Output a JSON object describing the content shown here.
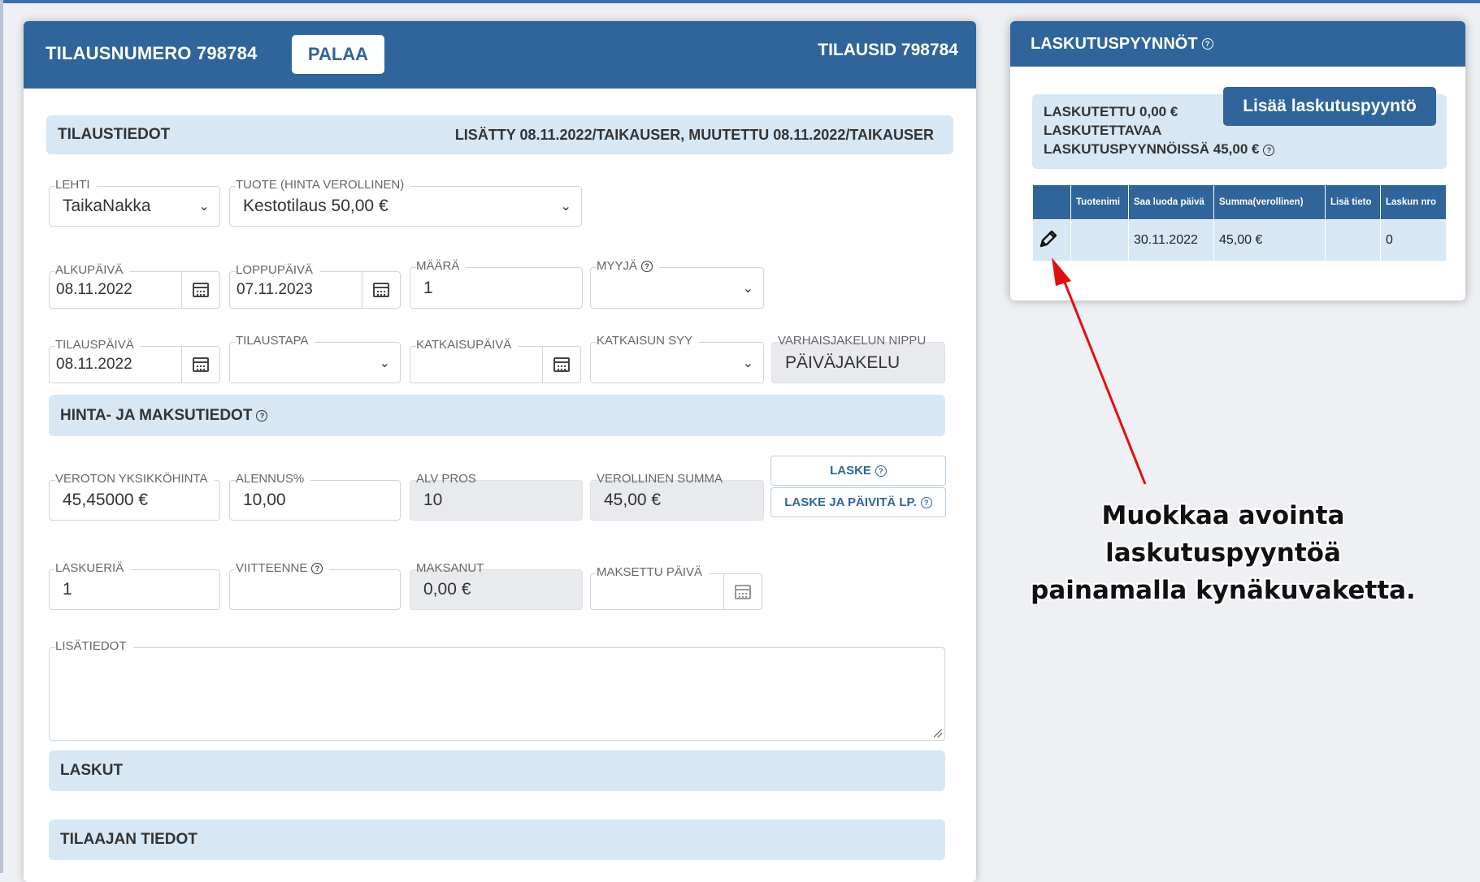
{
  "header": {
    "order_number": "TILAUSNUMERO 798784",
    "back_button": "PALAA",
    "order_id": "TILAUSID 798784"
  },
  "order_info": {
    "title": "TILAUSTIEDOT",
    "meta": "LISÄTTY 08.11.2022/TAIKAUSER, MUUTETTU 08.11.2022/TAIKAUSER"
  },
  "fields": {
    "magazine": {
      "label": "LEHTI",
      "value": "TaikaNakka"
    },
    "product": {
      "label": "TUOTE (HINTA VEROLLINEN)",
      "value": "Kestotilaus 50,00 €"
    },
    "start_date": {
      "label": "ALKUPÄIVÄ",
      "value": "08.11.2022"
    },
    "end_date": {
      "label": "LOPPUPÄIVÄ",
      "value": "07.11.2023"
    },
    "quantity": {
      "label": "MÄÄRÄ",
      "value": "1"
    },
    "seller": {
      "label": "MYYJÄ",
      "value": ""
    },
    "order_date": {
      "label": "TILAUSPÄIVÄ",
      "value": "08.11.2022"
    },
    "order_method": {
      "label": "TILAUSTAPA",
      "value": ""
    },
    "cutoff_date": {
      "label": "KATKAISUPÄIVÄ",
      "value": ""
    },
    "cutoff_reason": {
      "label": "KATKAISUN SYY",
      "value": ""
    },
    "early_bundle": {
      "label": "VARHAISJAKELUN NIPPU",
      "value": "PÄIVÄJAKELU"
    },
    "unit_price": {
      "label": "VEROTON YKSIKKÖHINTA",
      "value": "45,45000 €"
    },
    "discount": {
      "label": "ALENNUS%",
      "value": "10,00"
    },
    "vat": {
      "label": "ALV PROS",
      "value": "10"
    },
    "total": {
      "label": "VEROLLINEN SUMMA",
      "value": "45,00 €"
    },
    "installments": {
      "label": "LASKUERIÄ",
      "value": "1"
    },
    "reference": {
      "label": "VIITTEENNE",
      "value": ""
    },
    "paid": {
      "label": "MAKSANUT",
      "value": "0,00 €"
    },
    "paid_date": {
      "label": "MAKSETTU PÄIVÄ",
      "value": ""
    },
    "notes": {
      "label": "LISÄTIEDOT",
      "value": ""
    }
  },
  "price_section": {
    "title": "HINTA- JA MAKSUTIEDOT"
  },
  "buttons": {
    "calc": "LASKE",
    "calc_update": "LASKE JA PÄIVITÄ LP."
  },
  "invoices_section": {
    "title": "LASKUT"
  },
  "customer_section": {
    "title": "TILAAJAN TIEDOT"
  },
  "billing": {
    "title": "LASKUTUSPYYNNÖT",
    "invoiced": "LASKUTETTU 0,00 €",
    "to_invoice_line1": "LASKUTETTAVAA",
    "to_invoice_line2": "LASKUTUSPYYNNÖISSÄ 45,00 €",
    "add_button": "Lisää laskutuspyyntö",
    "columns": [
      "",
      "Tuotenimi",
      "Saa luoda päivä",
      "Summa(verollinen)",
      "Lisä tieto",
      "Laskun nro"
    ],
    "rows": [
      {
        "product": "",
        "date": "30.11.2022",
        "sum": "45,00 €",
        "info": "",
        "invoice_no": "0"
      }
    ]
  },
  "annotation": {
    "line1": "Muokkaa avointa laskutuspyyntöä",
    "line2": "painamalla kynäkuvaketta."
  },
  "colors": {
    "header_blue": "#2f659a",
    "section_light": "#d7e7f4",
    "arrow_red": "#e01010"
  }
}
